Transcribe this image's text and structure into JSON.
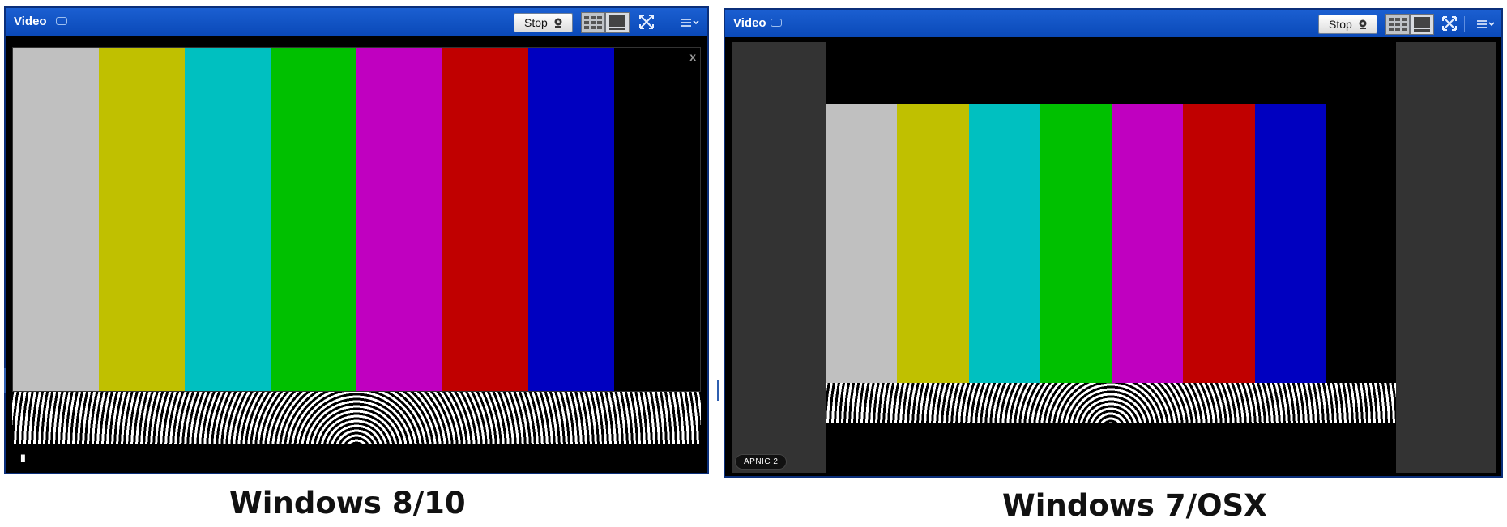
{
  "left_panel": {
    "title": "Video",
    "stop_label": "Stop",
    "close_label": "x",
    "pause_label": "II",
    "color_bars": [
      "#c0c0c0",
      "#c0c000",
      "#00c0c0",
      "#00c000",
      "#c000c0",
      "#c00000",
      "#0000c0",
      "#000000"
    ],
    "caption": "Windows 8/10"
  },
  "right_panel": {
    "title": "Video",
    "stop_label": "Stop",
    "badge": "APNIC 2",
    "color_bars": [
      "#c0c0c0",
      "#c0c000",
      "#00c0c0",
      "#00c000",
      "#c000c0",
      "#c00000",
      "#0000c0",
      "#000000"
    ],
    "caption": "Windows 7/OSX"
  },
  "icons": {
    "chat": "chat-bubble-icon",
    "camera": "webcam-icon",
    "grid": "grid-layout-icon",
    "full": "single-view-icon",
    "move": "move-arrows-icon",
    "menu": "pod-menu-icon"
  }
}
